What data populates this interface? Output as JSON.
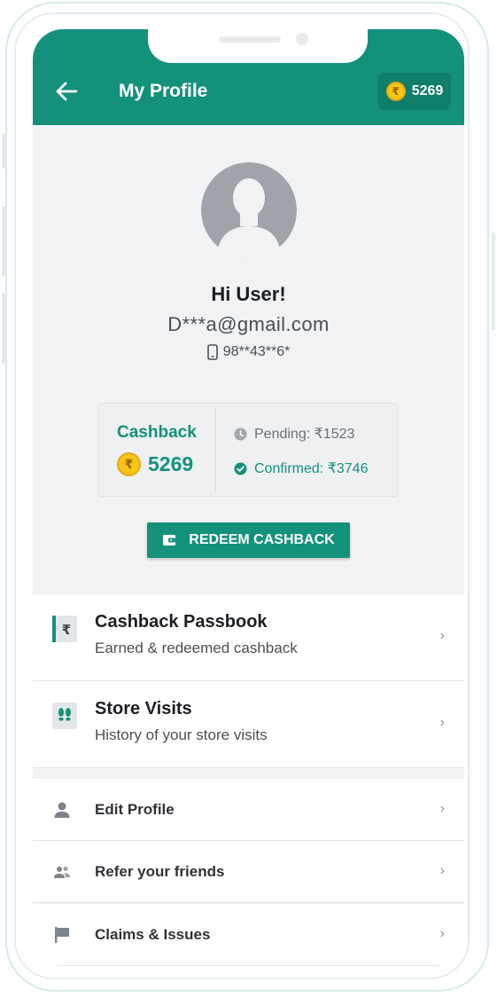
{
  "header": {
    "title": "My Profile",
    "coin_balance": "5269",
    "coin_symbol": "₹",
    "brand_color": "#14917b"
  },
  "profile": {
    "greeting": "Hi User!",
    "email": "D***a@gmail.com",
    "phone": "98**43**6*"
  },
  "cashback": {
    "label": "Cashback",
    "amount": "5269",
    "pending": "Pending: ₹1523",
    "confirmed": "Confirmed: ₹3746"
  },
  "redeem_button": {
    "label": "REDEEM CASHBACK"
  },
  "menu_primary": [
    {
      "title": "Cashback Passbook",
      "subtitle": "Earned & redeemed cashback",
      "icon": "rupee-passbook-icon"
    },
    {
      "title": "Store Visits",
      "subtitle": "History of your store visits",
      "icon": "footsteps-icon"
    }
  ],
  "menu_secondary": [
    {
      "label": "Edit Profile",
      "icon": "person-icon"
    },
    {
      "label": "Refer your friends",
      "icon": "people-icon"
    },
    {
      "label": "Claims & Issues",
      "icon": "flag-icon"
    }
  ],
  "chevron": "›"
}
